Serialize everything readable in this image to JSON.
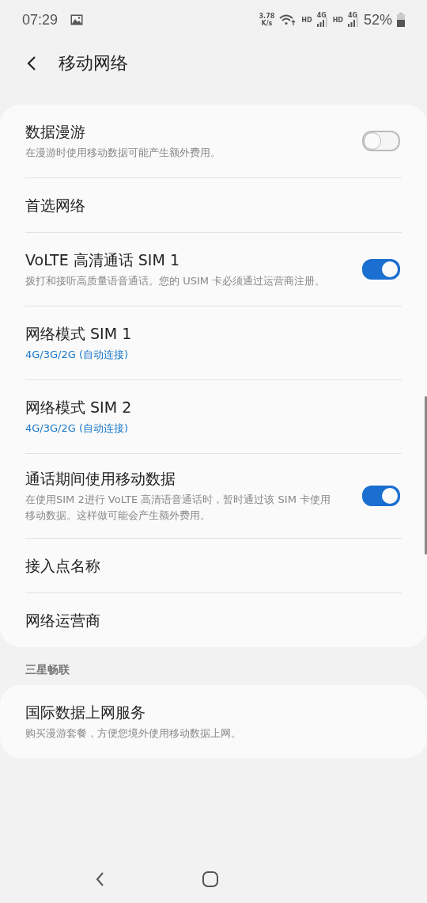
{
  "status_bar": {
    "time": "07:29",
    "net_speed": [
      "3.78",
      "K/s"
    ],
    "sims": [
      {
        "hd": "HD",
        "network": "4G"
      },
      {
        "hd": "HD",
        "network": "4G"
      }
    ],
    "battery": "52%"
  },
  "header": {
    "title": "移动网络"
  },
  "groups": [
    {
      "items": [
        {
          "kind": "toggle",
          "title": "数据漫游",
          "description": "在漫游时使用移动数据可能产生额外费用。",
          "on": false
        },
        {
          "kind": "plain",
          "title": "首选网络"
        },
        {
          "kind": "toggle",
          "title": "VoLTE 高清通话 SIM 1",
          "description": "拨打和接听高质量语音通话。您的 USIM 卡必须通过运营商注册。",
          "on": true
        },
        {
          "kind": "value",
          "title": "网络模式 SIM 1",
          "value": "4G/3G/2G (自动连接)"
        },
        {
          "kind": "value",
          "title": "网络模式 SIM 2",
          "value": "4G/3G/2G (自动连接)"
        },
        {
          "kind": "toggle",
          "title": "通话期间使用移动数据",
          "description": "在使用SIM 2进行 VoLTE 高清语音通话时，暂时通过该 SIM 卡使用移动数据。这样做可能会产生额外费用。",
          "on": true
        },
        {
          "kind": "plain",
          "title": "接入点名称"
        },
        {
          "kind": "plain",
          "title": "网络运营商"
        }
      ]
    },
    {
      "section": "三星畅联",
      "items": [
        {
          "kind": "plain",
          "title": "国际数据上网服务",
          "description": "购买漫游套餐，方便您境外使用移动数据上网。"
        }
      ]
    }
  ]
}
